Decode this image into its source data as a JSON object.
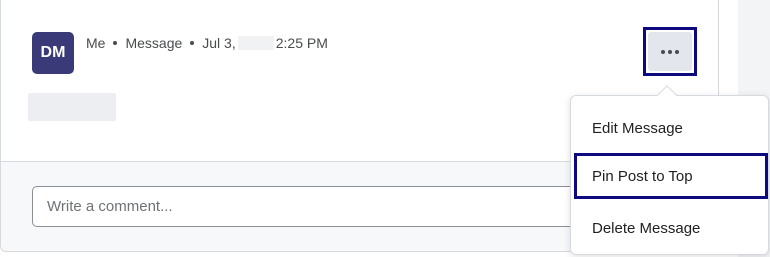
{
  "post": {
    "avatar_initials": "DM",
    "author": "Me",
    "type": "Message",
    "date": "Jul 3,",
    "time": "2:25 PM"
  },
  "comment": {
    "placeholder": "Write a comment..."
  },
  "menu": {
    "items": [
      {
        "label": "Edit Message"
      },
      {
        "label": "Pin Post to Top"
      },
      {
        "label": "Delete Message"
      }
    ]
  },
  "colors": {
    "avatar_bg": "#3b3a78",
    "focus_outline": "#0c0a7e"
  },
  "icons": {
    "more": "more-options-icon"
  }
}
